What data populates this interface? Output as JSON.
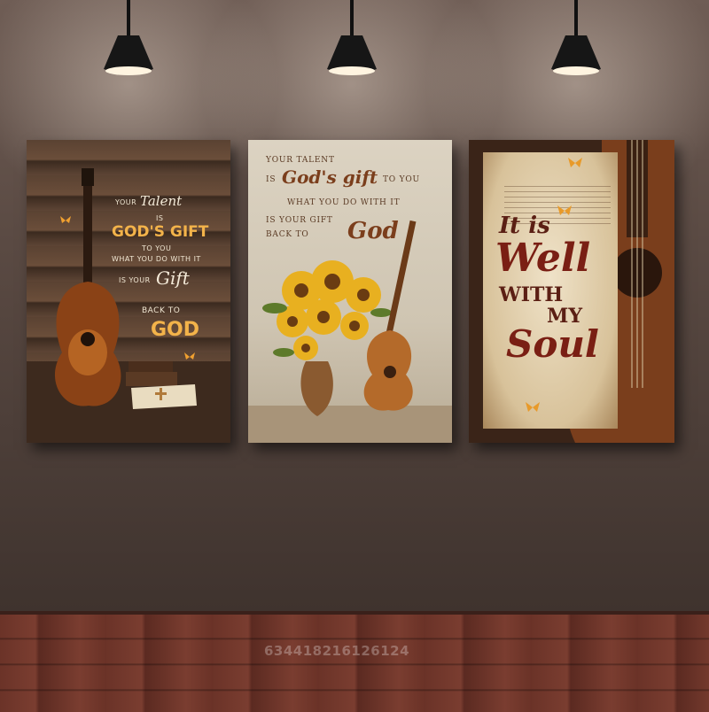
{
  "watermark": "634418216126124",
  "canvas_left": {
    "line1": "YOUR",
    "line1_script": "Talent",
    "line2": "IS",
    "line3": "GOD'S GIFT",
    "line4": "TO YOU",
    "line5": "WHAT YOU DO WITH IT",
    "line6": "IS YOUR",
    "line6_script": "Gift",
    "line7": "BACK TO",
    "line8": "GOD"
  },
  "canvas_middle": {
    "line1": "YOUR TALENT",
    "line2": "IS",
    "line2_script": "God's gift",
    "line2_tail": "TO YOU",
    "line3": "WHAT YOU DO WITH IT",
    "line4": "IS YOUR GIFT",
    "line5": "BACK TO",
    "line5_script": "God"
  },
  "canvas_right": {
    "line1": "It is",
    "line2": "Well",
    "line3": "WITH",
    "line4": "MY",
    "line5": "Soul"
  },
  "colors": {
    "wall": "#5a4a43",
    "floor": "#6b3328",
    "accent_gold": "#f3b34a"
  }
}
